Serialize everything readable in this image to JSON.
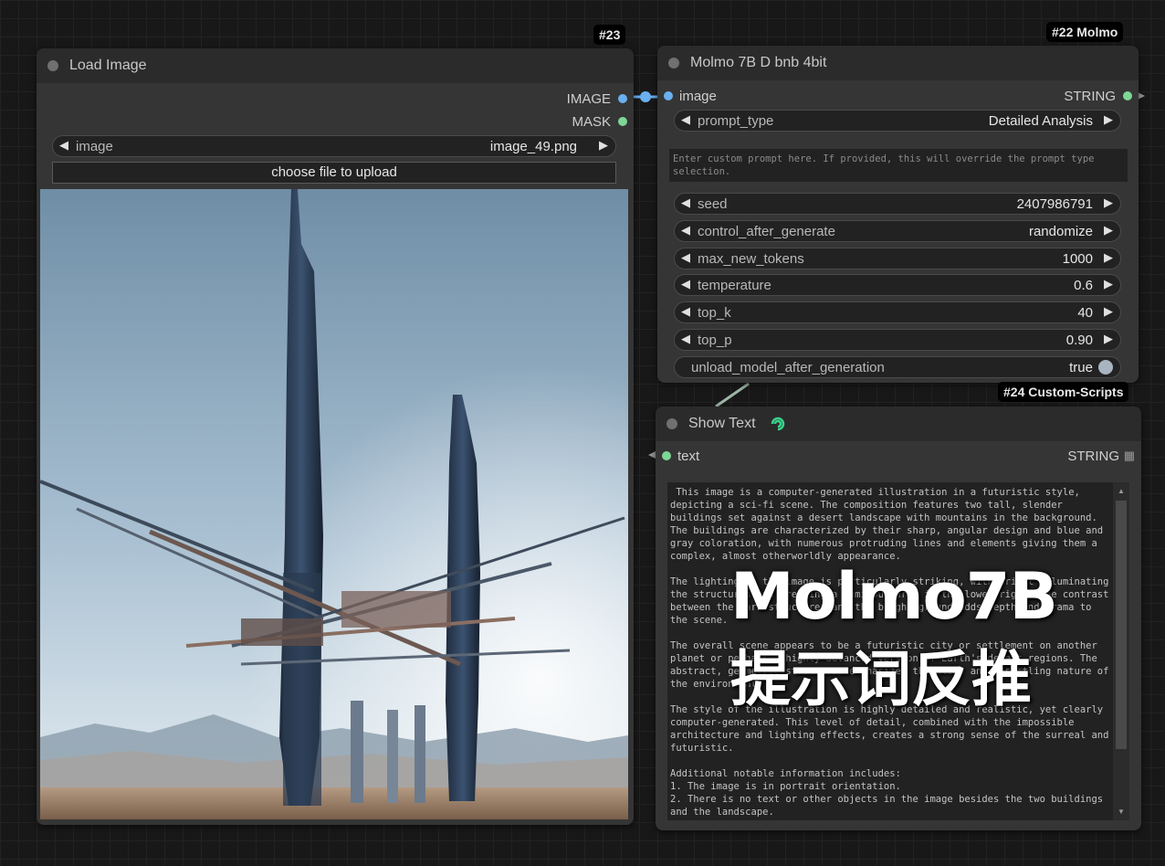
{
  "colors": {
    "image_slot": "#6ab0f0",
    "mask_slot": "#7ed696",
    "string_slot": "#7ed696",
    "link_image": "#6ab0f0",
    "link_string": "#9fb8a8",
    "brand_icon": "#3ad18a"
  },
  "load_image": {
    "badge": "#23",
    "title": "Load Image",
    "outputs": {
      "image": "IMAGE",
      "mask": "MASK"
    },
    "image_widget": {
      "label": "image",
      "value": "image_49.png"
    },
    "upload_label": "choose file to upload"
  },
  "molmo": {
    "badge": "#22 Molmo",
    "title": "Molmo 7B D bnb 4bit",
    "input_label": "image",
    "output_label": "STRING",
    "prompt_type": {
      "label": "prompt_type",
      "value": "Detailed Analysis"
    },
    "custom_prompt_placeholder": "Enter custom prompt here. If provided, this will override the prompt type selection.",
    "widgets": [
      {
        "label": "seed",
        "value": "2407986791"
      },
      {
        "label": "control_after_generate",
        "value": "randomize"
      },
      {
        "label": "max_new_tokens",
        "value": "1000"
      },
      {
        "label": "temperature",
        "value": "0.6"
      },
      {
        "label": "top_k",
        "value": "40"
      },
      {
        "label": "top_p",
        "value": "0.90"
      }
    ],
    "toggle": {
      "label": "unload_model_after_generation",
      "value": "true"
    }
  },
  "show_text": {
    "badge": "#24 Custom-Scripts",
    "title": "Show Text",
    "input_label": "text",
    "output_label": "STRING",
    "text": " This image is a computer-generated illustration in a futuristic style, depicting a sci-fi scene. The composition features two tall, slender buildings set against a desert landscape with mountains in the background. The buildings are characterized by their sharp, angular design and blue and gray coloration, with numerous protruding lines and elements giving them a complex, almost otherworldly appearance.\n\nThe lighting in the image is particularly striking, with bright illuminating the structures and creating a luminous area in the lower right. The contrast between the dark structures and the bright ground adds depth and drama to the scene.\n\nThe overall scene appears to be a futuristic city or settlement on another planet or perhaps a highly advanced version of Earth's desert regions. The abstract, geometric structures emphasizes the alien and unsettling nature of the environment.\n\nThe style of the illustration is highly detailed and realistic, yet clearly computer-generated. This level of detail, combined with the impossible architecture and lighting effects, creates a strong sense of the surreal and futuristic.\n\nAdditional notable information includes:\n1. The image is in portrait orientation.\n2. There is no text or other objects in the image besides the two buildings and the landscape."
  },
  "overlay": {
    "line1": "Molmo7B",
    "line2": "提示词反推"
  }
}
